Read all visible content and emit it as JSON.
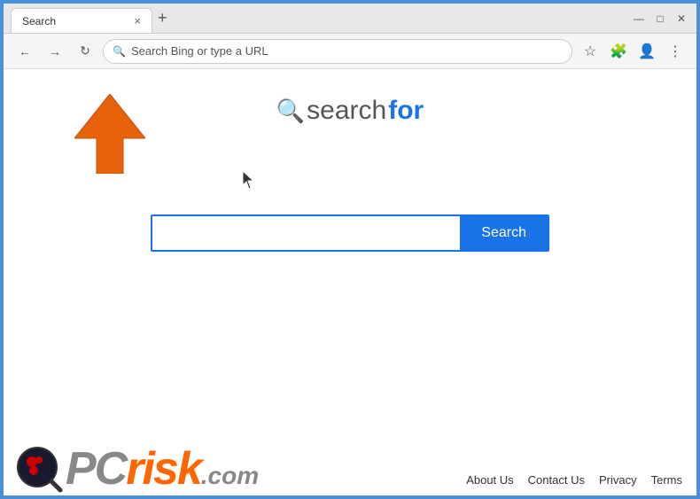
{
  "window": {
    "title": "Search",
    "tab_label": "Search",
    "tab_close": "×",
    "tab_new": "+",
    "controls": {
      "minimize": "—",
      "maximize": "□",
      "close": "✕"
    }
  },
  "nav": {
    "back": "←",
    "forward": "→",
    "refresh": "↻",
    "address_placeholder": "Search Bing or type a URL",
    "search_icon": "🔍",
    "favorite_icon": "☆",
    "extension_icon": "🧩",
    "profile_icon": "👤",
    "menu_icon": "⋮"
  },
  "page": {
    "logo": {
      "icon": "🔍",
      "text_search": "search",
      "text_for": "for"
    },
    "search_input_placeholder": "",
    "search_button_label": "Search"
  },
  "footer": {
    "pc_text": "PC",
    "risk_text": "risk",
    "com_text": ".com",
    "links": [
      {
        "label": "About Us",
        "id": "about-us"
      },
      {
        "label": "Contact Us",
        "id": "contact-us"
      },
      {
        "label": "Privacy",
        "id": "privacy"
      },
      {
        "label": "Terms",
        "id": "terms"
      }
    ]
  }
}
